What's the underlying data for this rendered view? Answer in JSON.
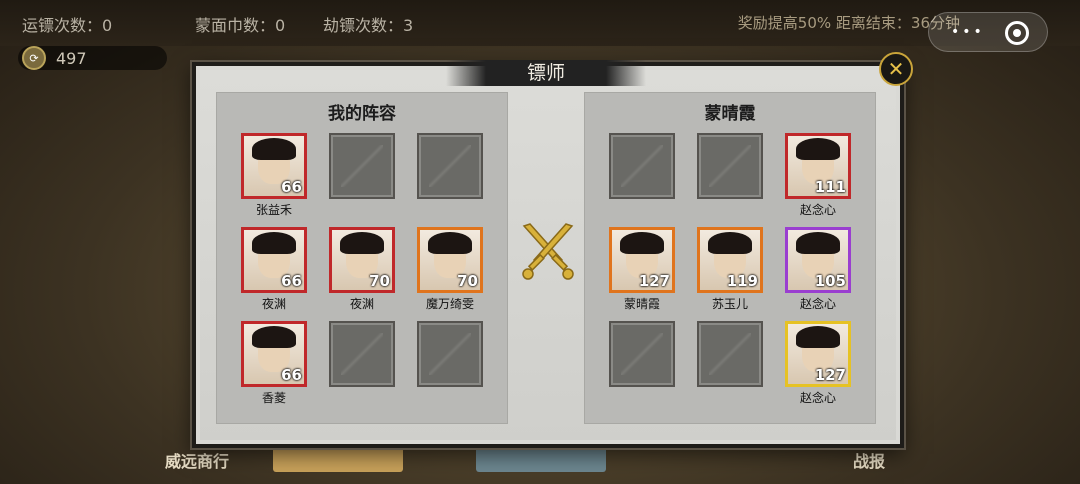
{
  "top": {
    "escort_count_label": "运镖次数：0",
    "mask_count_label": "蒙面巾数：0",
    "rob_count_label": "劫镖次数：3",
    "reward_text": "奖励提高50%  距离结束：36分钟",
    "coin_value": "497"
  },
  "dialog": {
    "title": "镖师",
    "left_panel_title": "我的阵容",
    "right_panel_title": "蒙晴霞"
  },
  "left_slots": [
    {
      "name": "张益禾",
      "level": "66",
      "rarity": "red"
    },
    {
      "name": "",
      "level": "",
      "rarity": "empty"
    },
    {
      "name": "",
      "level": "",
      "rarity": "empty"
    },
    {
      "name": "夜渊",
      "level": "66",
      "rarity": "red"
    },
    {
      "name": "夜渊",
      "level": "70",
      "rarity": "red"
    },
    {
      "name": "魔万绮雯",
      "level": "70",
      "rarity": "orange"
    },
    {
      "name": "香菱",
      "level": "66",
      "rarity": "red"
    },
    {
      "name": "",
      "level": "",
      "rarity": "empty"
    },
    {
      "name": "",
      "level": "",
      "rarity": "empty"
    }
  ],
  "right_slots": [
    {
      "name": "",
      "level": "",
      "rarity": "empty"
    },
    {
      "name": "",
      "level": "",
      "rarity": "empty"
    },
    {
      "name": "赵念心",
      "level": "111",
      "rarity": "red"
    },
    {
      "name": "蒙晴霞",
      "level": "127",
      "rarity": "orange"
    },
    {
      "name": "苏玉儿",
      "level": "119",
      "rarity": "orange"
    },
    {
      "name": "赵念心",
      "level": "105",
      "rarity": "purple"
    },
    {
      "name": "",
      "level": "",
      "rarity": "empty"
    },
    {
      "name": "",
      "level": "",
      "rarity": "empty"
    },
    {
      "name": "赵念心",
      "level": "127",
      "rarity": "gold"
    }
  ],
  "bottom": {
    "left_label": "威远商行",
    "right_label": "战报"
  },
  "colors": {
    "red": "#c0282a",
    "orange": "#e0741d",
    "purple": "#9a3ed0",
    "gold": "#e6c224"
  }
}
